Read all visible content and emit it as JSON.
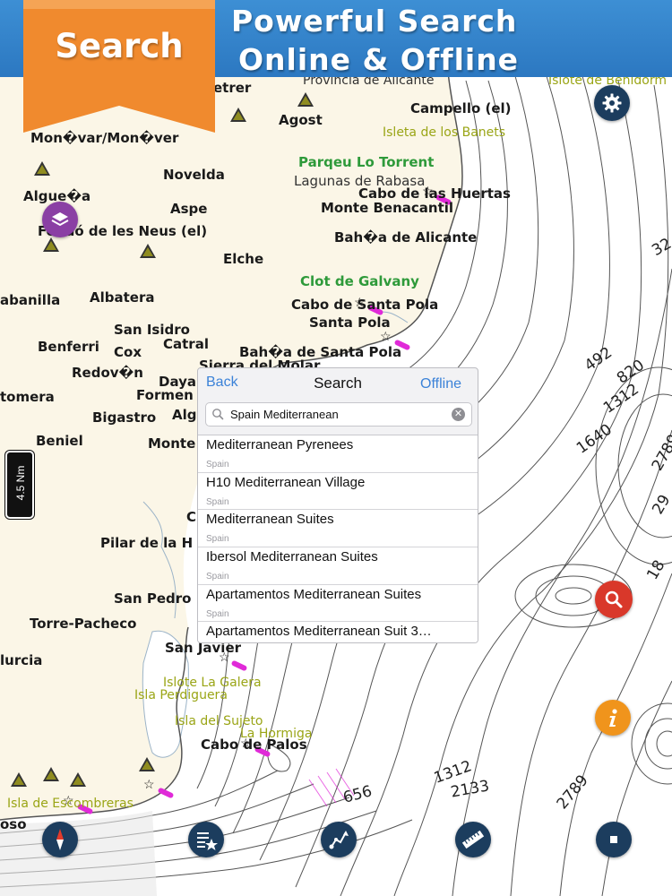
{
  "header": {
    "badge": "Search",
    "title_line1": "Powerful Search",
    "title_line2": "Online & Offline"
  },
  "map": {
    "labels": [
      {
        "text": "etrer"
      },
      {
        "text": "Provincia de Alicante"
      },
      {
        "text": "Islote de Benidorm"
      },
      {
        "text": "Agost"
      },
      {
        "text": "Campello (el)"
      },
      {
        "text": "Isleta de los Banets"
      },
      {
        "text": "Mon�var/Mon�ver"
      },
      {
        "text": "Parqeu Lo Torrent"
      },
      {
        "text": "Novelda"
      },
      {
        "text": "Lagunas de Rabasa"
      },
      {
        "text": "Cabo de las Huertas"
      },
      {
        "text": "Algue�a"
      },
      {
        "text": "Aspe"
      },
      {
        "text": "Monte Benacantil"
      },
      {
        "text": "Fondó de les Neus (el)"
      },
      {
        "text": "Bah�a de Alicante"
      },
      {
        "text": "Elche"
      },
      {
        "text": "Clot de Galvany"
      },
      {
        "text": "abanilla"
      },
      {
        "text": "Albatera"
      },
      {
        "text": "Cabo de Santa Pola"
      },
      {
        "text": "Santa Pola"
      },
      {
        "text": "San Isidro"
      },
      {
        "text": "Benferri"
      },
      {
        "text": "Catral"
      },
      {
        "text": "Cox"
      },
      {
        "text": "Bah�a de Santa Pola"
      },
      {
        "text": "Redov�n"
      },
      {
        "text": "Sierra del Molar"
      },
      {
        "text": "Daya"
      },
      {
        "text": "tomera"
      },
      {
        "text": "Formen"
      },
      {
        "text": "Bigastro"
      },
      {
        "text": "Alg"
      },
      {
        "text": "Beniel"
      },
      {
        "text": "Monte"
      },
      {
        "text": "C"
      },
      {
        "text": "Pilar de la H"
      },
      {
        "text": "San Pedro"
      },
      {
        "text": "Torre-Pacheco"
      },
      {
        "text": "San Javier"
      },
      {
        "text": "lurcia"
      },
      {
        "text": "Islote La Galera"
      },
      {
        "text": "Isla Perdiguera"
      },
      {
        "text": "Isla del Sujeto"
      },
      {
        "text": "La Hormiga"
      },
      {
        "text": "Cabo de Palos"
      },
      {
        "text": "Isla de Escombreras"
      },
      {
        "text": "oso"
      }
    ],
    "depths": [
      "32",
      "492",
      "820",
      "1312",
      "1640",
      "2789",
      "29",
      "1312",
      "1312",
      "2133",
      "2789",
      "656",
      "18"
    ],
    "scale": "4.5 Nm"
  },
  "search": {
    "back_label": "Back",
    "title": "Search",
    "offline_label": "Offline",
    "query": "Spain Mediterranean",
    "results": [
      {
        "name": "Mediterranean Pyrenees",
        "country": "Spain"
      },
      {
        "name": "H10 Mediterranean Village",
        "country": "Spain"
      },
      {
        "name": "Mediterranean Suites",
        "country": "Spain"
      },
      {
        "name": "Ibersol Mediterranean Suites",
        "country": "Spain"
      },
      {
        "name": "Apartamentos Mediterranean Suites",
        "country": "Spain"
      },
      {
        "name": "Apartamentos Mediterranean Suit 3…",
        "country": ""
      }
    ]
  },
  "colors": {
    "land": "#fbf6e7",
    "water": "#ffffff",
    "banner": "#2c78c1",
    "ribbon": "#f08a2e",
    "toolbar_button": "#1c3d5e",
    "search_button": "#d9382a",
    "info_button": "#f0941c",
    "layers_button": "#8a3fa4",
    "ios_blue": "#3b82d8"
  },
  "icons": [
    "gear-icon",
    "layers-icon",
    "search-icon",
    "info-icon",
    "compass-icon",
    "route-list-icon",
    "route-edit-icon",
    "ruler-icon",
    "stop-icon"
  ]
}
